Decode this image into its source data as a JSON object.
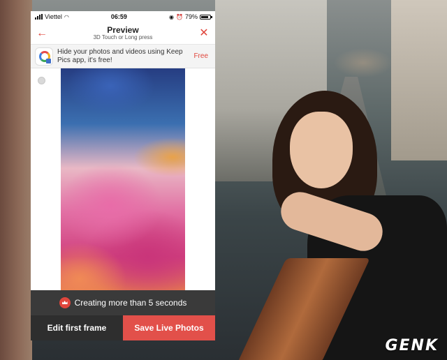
{
  "status_bar": {
    "carrier": "Viettel",
    "time": "06:59",
    "battery": "79%"
  },
  "nav": {
    "title": "Preview",
    "subtitle": "3D Touch or Long press"
  },
  "promo": {
    "text": "Hide your photos and videos using Keep Pics app, it's free!",
    "cta": "Free"
  },
  "warning": {
    "text": "Creating more than 5 seconds"
  },
  "actions": {
    "edit_label": "Edit first frame",
    "save_label": "Save Live Photos"
  },
  "watermark": {
    "text": "GENK"
  },
  "colors": {
    "accent": "#e0463c",
    "save_button": "#e2504a",
    "warning_bar": "#3a3a3a"
  }
}
